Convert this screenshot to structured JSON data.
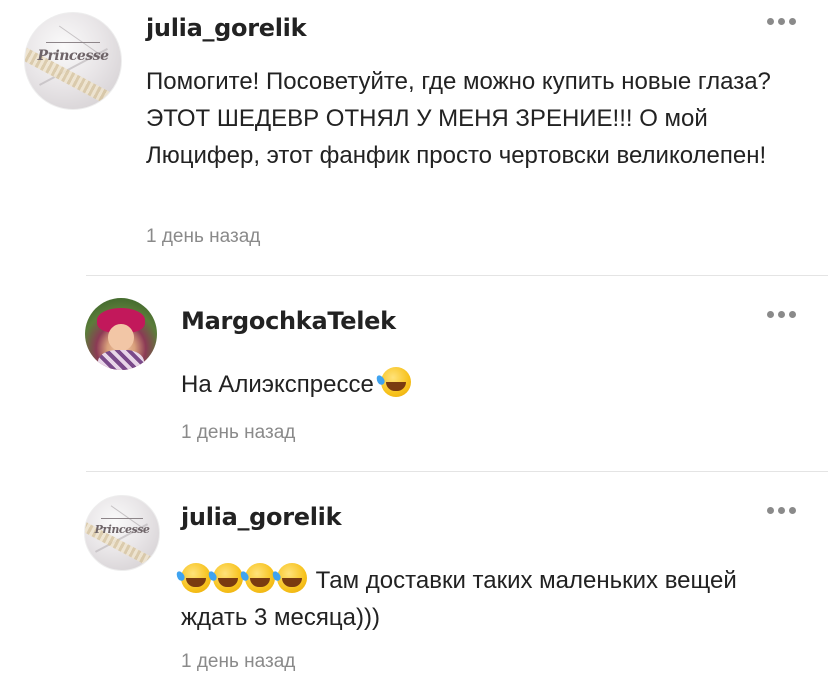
{
  "comments": [
    {
      "username": "julia_gorelik",
      "avatar_text": "Princesse",
      "text": "Помогите! Посоветуйте, где можно купить новые глаза? ЭТОТ ШЕДЕВР ОТНЯЛ У МЕНЯ ЗРЕНИЕ!!! О мой Люцифер, этот фанфик просто чертовски великолепен!",
      "time": "1 день назад"
    },
    {
      "username": "MargochkaTelek",
      "text": "На Алиэкспрессе",
      "emoji_count": 1,
      "time": "1 день назад"
    },
    {
      "username": "julia_gorelik",
      "avatar_text": "Princesse",
      "text": "Там доставки таких маленьких вещей ждать 3 месяца)))",
      "emoji_count": 4,
      "time": "1 день назад"
    }
  ],
  "icons": {
    "more": "more-horizontal-icon",
    "emoji": "rolling-on-floor-laughing-icon"
  },
  "colors": {
    "text": "#222222",
    "muted": "#8a8a8a",
    "divider": "#e4e4e4"
  }
}
